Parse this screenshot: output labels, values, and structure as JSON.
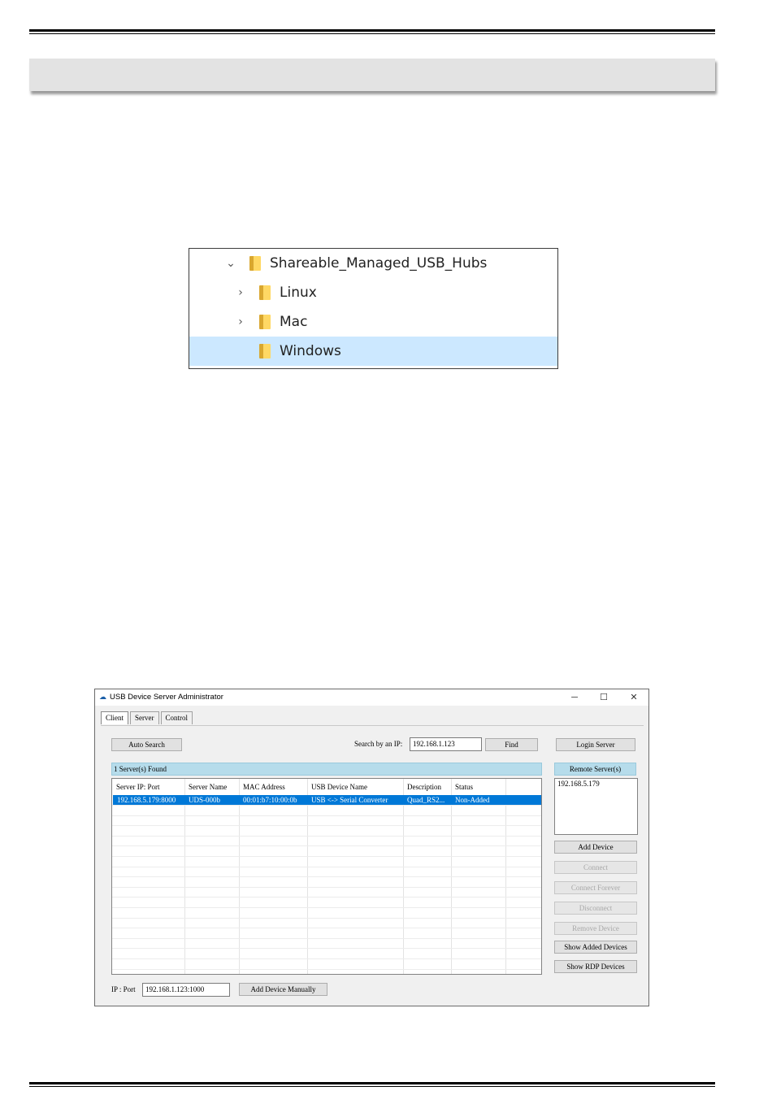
{
  "tree": {
    "items": [
      {
        "label": "Shareable_Managed_USB_Hubs",
        "expanded": true,
        "selected": false,
        "level": 0
      },
      {
        "label": "Linux",
        "expanded": false,
        "selected": false,
        "level": 1
      },
      {
        "label": "Mac",
        "expanded": false,
        "selected": false,
        "level": 1
      },
      {
        "label": "Windows",
        "expanded": null,
        "selected": true,
        "level": 1
      }
    ]
  },
  "app": {
    "title": "USB Device Server Administrator",
    "controls": {
      "minimize": "─",
      "maximize": "☐",
      "close": "✕"
    },
    "tabs": [
      "Client",
      "Server",
      "Control"
    ],
    "active_tab": "Client",
    "auto_search_label": "Auto Search",
    "search_ip_label": "Search by an IP:",
    "search_ip_value": "192.168.1.123",
    "find_label": "Find",
    "login_server_label": "Login Server",
    "found_label": "1 Server(s) Found",
    "remote_servers_label": "Remote Server(s)",
    "remote_servers": [
      "192.168.5.179"
    ],
    "columns": [
      "Server IP: Port",
      "Server Name",
      "MAC Address",
      "USB Device Name",
      "Description",
      "Status"
    ],
    "rows": [
      [
        "192.168.5.179:8000",
        "UDS-000b",
        "00:01:b7:10:00:0b",
        "USB <-> Serial Converter",
        "Quad_RS2...",
        "Non-Added"
      ]
    ],
    "side_buttons": [
      {
        "label": "Add Device",
        "enabled": true
      },
      {
        "label": "Connect",
        "enabled": false
      },
      {
        "label": "Connect Forever",
        "enabled": false
      },
      {
        "label": "Disconnect",
        "enabled": false
      },
      {
        "label": "Remove Device",
        "enabled": false
      },
      {
        "label": "Show Added Devices",
        "enabled": true
      },
      {
        "label": "Show RDP Devices",
        "enabled": true
      }
    ],
    "ip_port_label": "IP : Port",
    "ip_port_value": "192.168.1.123:1000",
    "add_manual_label": "Add Device Manually"
  },
  "colors": {
    "selection": "#0078d7",
    "tree_selection": "#cce8ff",
    "header_blue": "#b6dceb",
    "folder": "#ffd864"
  },
  "icons": {
    "tree_expanded": "chevron-down-icon",
    "tree_collapsed": "chevron-right-icon",
    "tree_item": "folder-icon",
    "app": "cloud-icon"
  }
}
